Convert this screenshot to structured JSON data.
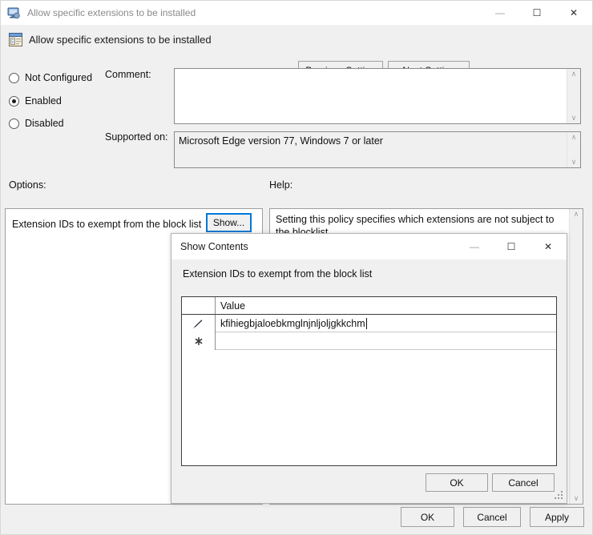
{
  "policy_window": {
    "titlebar": {
      "icon": "policy-monitor-icon",
      "title": "Allow specific extensions to be installed",
      "minimize": "—",
      "maximize": "☐",
      "close": "✕"
    },
    "header": {
      "icon": "policy-setting-icon",
      "title": "Allow specific extensions to be installed",
      "previous_setting": "Previous Setting",
      "next_setting": "Next Setting"
    },
    "state_options": [
      {
        "label": "Not Configured",
        "selected": false
      },
      {
        "label": "Enabled",
        "selected": true
      },
      {
        "label": "Disabled",
        "selected": false
      }
    ],
    "comment": {
      "label": "Comment:",
      "value": ""
    },
    "supported_on": {
      "label": "Supported on:",
      "value": "Microsoft Edge version 77, Windows 7 or later"
    },
    "options": {
      "label": "Options:",
      "setting_label": "Extension IDs to exempt from the block list",
      "show_button": "Show..."
    },
    "help": {
      "label": "Help:",
      "text": "Setting this policy specifies which extensions are not subject to the blocklist."
    },
    "footer": {
      "ok": "OK",
      "cancel": "Cancel",
      "apply": "Apply"
    }
  },
  "show_contents_dialog": {
    "titlebar": {
      "title": "Show Contents",
      "minimize": "—",
      "maximize": "☐",
      "close": "✕"
    },
    "subtitle": "Extension IDs to exempt from the block list",
    "grid": {
      "columns": [
        "",
        "Value"
      ],
      "rows": [
        {
          "marker": "edit-pencil-icon",
          "marker_glyph": "✐",
          "value": "kfihiegbjaloebkmglnjnljoljgkkchm",
          "editing": true
        },
        {
          "marker": "new-row-asterisk-icon",
          "marker_glyph": "✱",
          "value": "",
          "editing": false
        }
      ]
    },
    "footer": {
      "ok": "OK",
      "cancel": "Cancel"
    }
  },
  "colors": {
    "window_background": "#f0f0f0",
    "titlebar_background": "#ffffff",
    "panel_background": "#ffffff",
    "focus_accent": "#0078d7",
    "border": "#9e9e9e",
    "text": "#111111",
    "inactive_title_text": "#8a8a8a"
  },
  "scroll_glyphs": {
    "up": "∧",
    "down": "∨"
  }
}
